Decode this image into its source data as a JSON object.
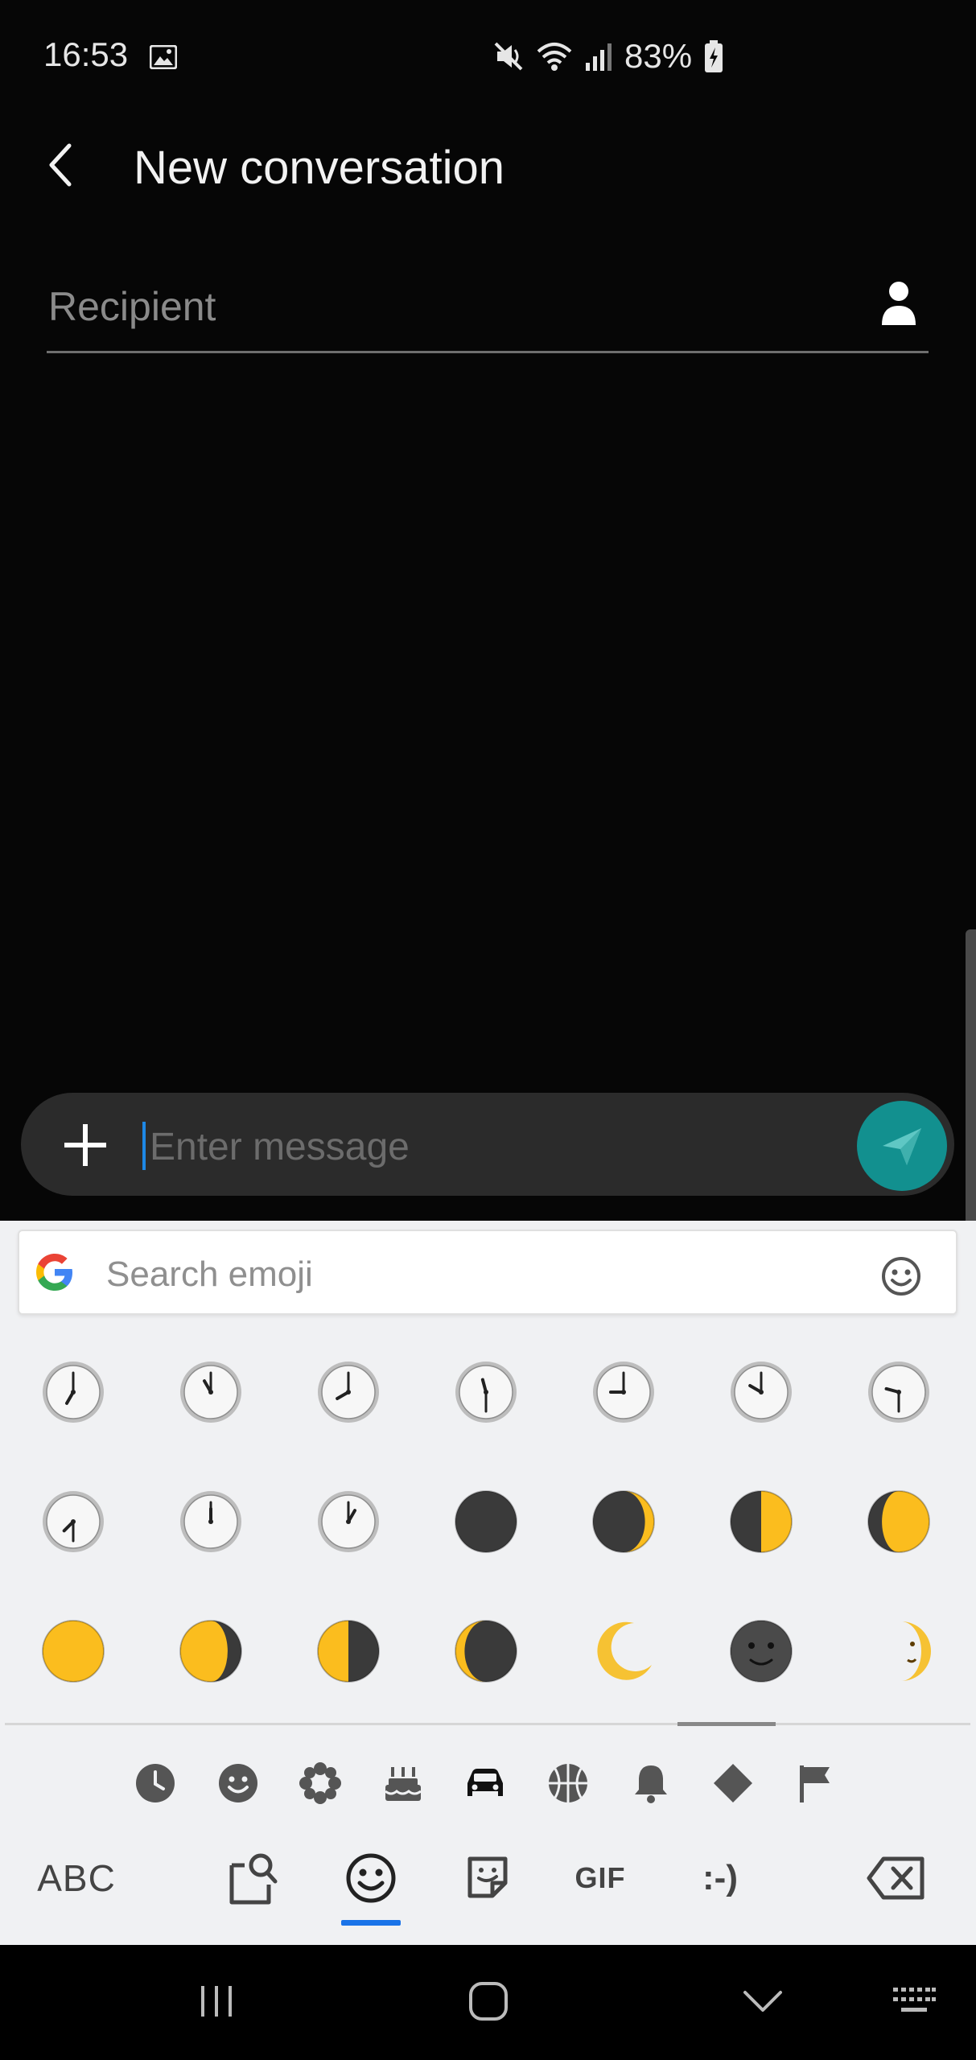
{
  "status_bar": {
    "time": "16:53",
    "battery": "83%",
    "icons": [
      "gallery-icon",
      "mute-icon",
      "wifi-icon",
      "signal-icon",
      "battery-charging-icon"
    ]
  },
  "header": {
    "title": "New conversation",
    "back_icon": "chevron-left-icon"
  },
  "recipient": {
    "placeholder": "Recipient",
    "value": "",
    "contact_icon": "person-icon"
  },
  "compose": {
    "attach_icon": "plus-icon",
    "placeholder": "Enter message",
    "value": "",
    "send_icon": "send-icon",
    "send_color": "#12908f"
  },
  "keyboard": {
    "search_placeholder": "Search emoji",
    "search_icon": "google-logo-icon",
    "emoji_rows": [
      [
        "clock-7",
        "clock-11",
        "clock-8",
        "clock-11-30",
        "clock-9",
        "clock-10",
        "clock-9-30"
      ],
      [
        "clock-7-30",
        "clock-12",
        "clock-1",
        "new-moon",
        "waxing-crescent-moon",
        "first-quarter-moon",
        "waxing-gibbous-moon"
      ],
      [
        "full-moon",
        "waning-gibbous-moon",
        "last-quarter-moon",
        "waning-crescent-moon",
        "crescent-moon",
        "new-moon-face",
        "first-quarter-moon-face"
      ]
    ],
    "categories": [
      "recent-icon",
      "smileys-icon",
      "nature-icon",
      "food-icon",
      "travel-icon",
      "activity-icon",
      "objects-icon",
      "symbols-icon",
      "flags-icon"
    ],
    "active_category": "travel-icon",
    "bottom_row": {
      "abc_label": "ABC",
      "gif_label": "GIF",
      "emoticon_label": ":-)",
      "active_tab": "emoji-tab",
      "accent": "#1a73e8"
    }
  },
  "nav_bar": {
    "icons": [
      "recents-icon",
      "home-icon",
      "back-down-icon",
      "keyboard-icon"
    ]
  }
}
